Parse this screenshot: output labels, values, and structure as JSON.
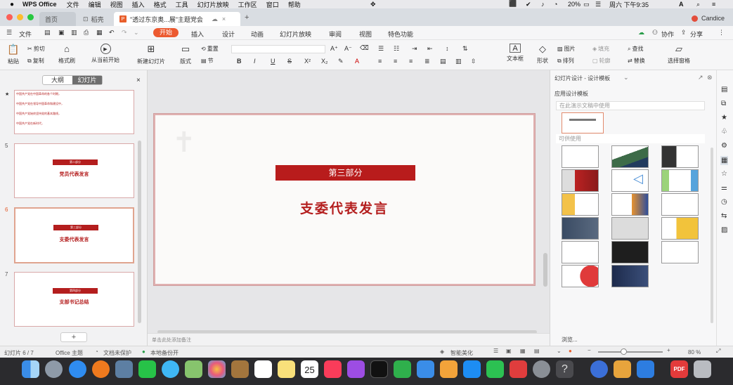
{
  "menubar": {
    "app": "WPS Office",
    "items": [
      "文件",
      "编辑",
      "视图",
      "插入",
      "格式",
      "工具",
      "幻灯片放映",
      "工作区",
      "窗口",
      "帮助"
    ],
    "battery": "20%",
    "clock": "周六 下午9:35",
    "user": "Candice"
  },
  "tabs": {
    "home": "首页",
    "draft": "稻壳",
    "doc": "\"透过东京奥...展\"主题党会",
    "add": "+"
  },
  "ribbon": {
    "file": "文件",
    "tabs": [
      "开始",
      "插入",
      "设计",
      "动画",
      "幻灯片放映",
      "审阅",
      "视图",
      "特色功能"
    ],
    "collab": "协作",
    "share": "分享"
  },
  "toolbar": {
    "paste": "粘贴",
    "cut": "剪切",
    "copy": "复制",
    "format": "格式刷",
    "play": "从当前开始",
    "newslide": "新建幻灯片",
    "layout": "版式",
    "reset": "重置",
    "section": "节",
    "textbox": "文本框",
    "shape": "形状",
    "picture": "图片",
    "fill": "填充",
    "arrange": "排列",
    "outline": "轮廓",
    "find": "查找",
    "replace": "替换",
    "select": "选择窗格"
  },
  "panel": {
    "outline_tab": "大纲",
    "slides_tab": "幻灯片",
    "add": "+",
    "lines": [
      "中国共产党在中国革命的各个时期，",
      "中国共产党在领导中国革命和建设中，",
      "中国共产党始终坚持党的基本路线，",
      "中国共产党在新时代，"
    ]
  },
  "slides": [
    {
      "num": "5",
      "header": "第二部分",
      "title": "党员代表发言"
    },
    {
      "num": "6",
      "header": "第三部分",
      "title": "支委代表发言"
    },
    {
      "num": "7",
      "header": "第四部分",
      "title": "支部书记总结"
    }
  ],
  "main_slide": {
    "header": "第三部分",
    "title": "支委代表发言"
  },
  "notes": "单击此处添加备注",
  "design": {
    "title": "幻灯片设计 - 设计模板",
    "applied_label": "应用设计模板",
    "search_placeholder": "在此演示文稿中使用",
    "available": "可供使用",
    "browse": "浏览..."
  },
  "status": {
    "slide": "幻灯片 6 / 7",
    "theme": "Office 主题",
    "protect": "文档未保护",
    "backup": "本地备份开",
    "beautify": "智能美化",
    "zoom": "80 %"
  },
  "dock": {
    "calendar": "25",
    "pdf": "PDF"
  }
}
